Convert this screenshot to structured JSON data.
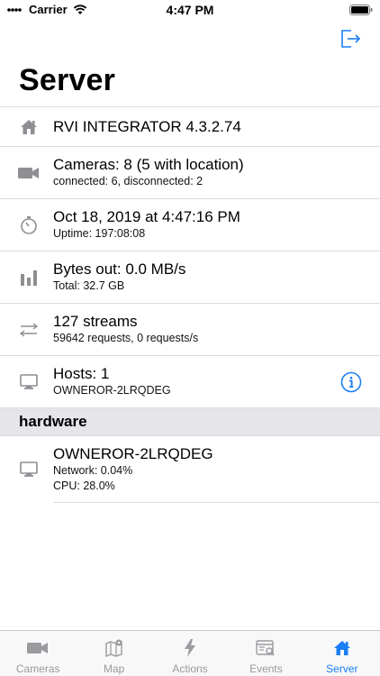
{
  "status_bar": {
    "carrier": "Carrier",
    "time": "4:47 PM"
  },
  "nav": {
    "title": "Server"
  },
  "rows": [
    {
      "icon": "home-icon",
      "title": "RVI INTEGRATOR 4.3.2.74"
    },
    {
      "icon": "video-camera-icon",
      "title": "Cameras: 8 (5 with location)",
      "subtitle": "connected: 6, disconnected: 2"
    },
    {
      "icon": "stopwatch-icon",
      "title": "Oct 18, 2019 at 4:47:16 PM",
      "subtitle": "Uptime: 197:08:08"
    },
    {
      "icon": "bar-chart-icon",
      "title": "Bytes out: 0.0 MB/s",
      "subtitle": "Total: 32.7 GB"
    },
    {
      "icon": "arrows-exchange-icon",
      "title": "127 streams",
      "subtitle": "59642 requests, 0 requests/s"
    },
    {
      "icon": "monitor-icon",
      "title": "Hosts: 1",
      "subtitle": "OWNEROR-2LRQDEG"
    }
  ],
  "hardware": {
    "header": "hardware",
    "title": "OWNEROR-2LRQDEG",
    "network": "Network: 0.04%",
    "cpu": "CPU: 28.0%"
  },
  "tabs": [
    {
      "label": "Cameras",
      "icon": "video-camera-icon",
      "active": false
    },
    {
      "label": "Map",
      "icon": "map-pin-icon",
      "active": false
    },
    {
      "label": "Actions",
      "icon": "lightning-icon",
      "active": false
    },
    {
      "label": "Events",
      "icon": "event-search-icon",
      "active": false
    },
    {
      "label": "Server",
      "icon": "home-icon",
      "active": true
    }
  ],
  "colors": {
    "accent": "#1a7ef5",
    "icon_gray": "#8e8e93",
    "section_bg": "#e5e5ea"
  }
}
